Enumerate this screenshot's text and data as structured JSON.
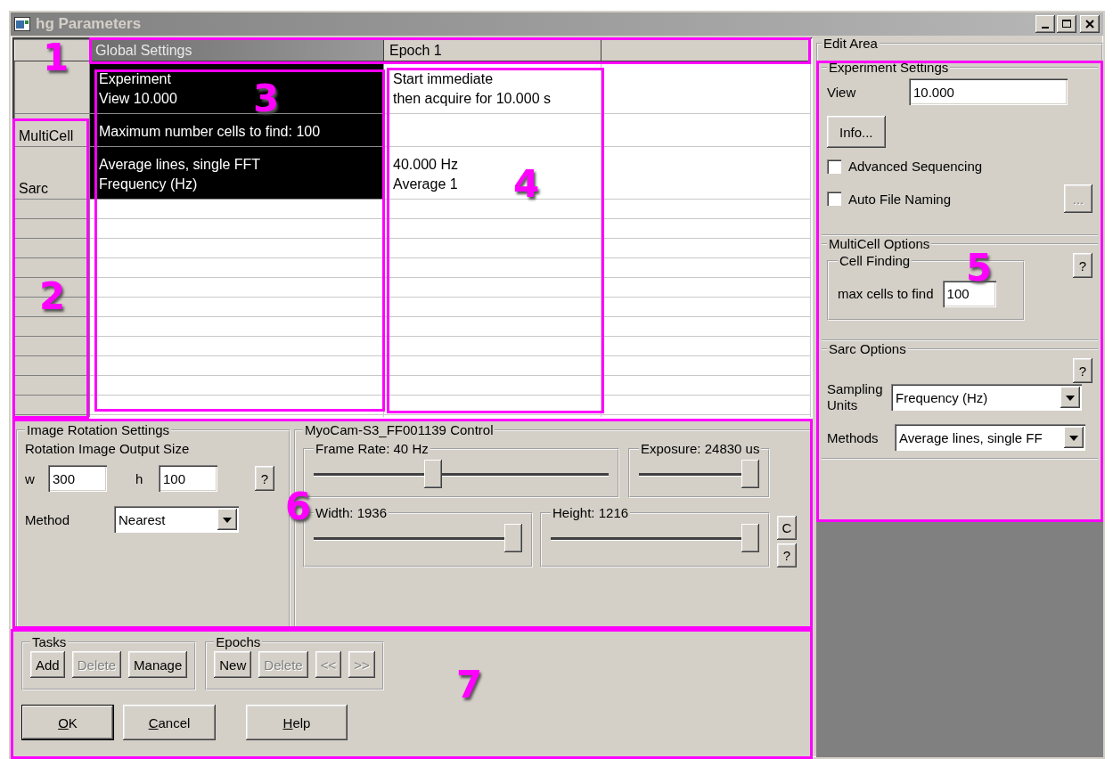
{
  "window": {
    "title": "hg Parameters"
  },
  "grid": {
    "columns": [
      {
        "label": "Global Settings",
        "selected": true
      },
      {
        "label": "Epoch 1",
        "selected": false
      }
    ],
    "rows": [
      {
        "cells": [
          {
            "lines": [
              "Experiment",
              "View 10.000"
            ]
          },
          {
            "lines": [
              "Start immediate",
              "then acquire for 10.000 s"
            ]
          }
        ]
      },
      {
        "header": "MultiCell",
        "cells": [
          {
            "lines": [
              "Maximum number cells to find: 100"
            ]
          }
        ]
      },
      {
        "header": "Sarc",
        "cells": [
          {
            "lines": [
              "Average lines, single FFT",
              "Frequency (Hz)"
            ]
          },
          {
            "lines": [
              "40.000 Hz",
              "Average 1"
            ]
          }
        ]
      }
    ]
  },
  "rotation": {
    "title": "Image Rotation Settings",
    "subtitle": "Rotation Image Output Size",
    "w_label": "w",
    "w_value": "300",
    "h_label": "h",
    "h_value": "100",
    "help": "?",
    "method_label": "Method",
    "method_value": "Nearest"
  },
  "camera": {
    "title": "MyoCam-S3_FF001139 Control",
    "sliders": [
      {
        "label": "Frame Rate: 40 Hz",
        "level": 0.4
      },
      {
        "label": "Exposure: 24830 us",
        "level": 1
      },
      {
        "label": "Width: 1936",
        "level": 1
      },
      {
        "label": "Height: 1216",
        "level": 1
      }
    ],
    "buttons": [
      "C",
      "?"
    ]
  },
  "tasks": {
    "title": "Tasks",
    "buttons": [
      {
        "label": "Add",
        "disabled": false
      },
      {
        "label": "Delete",
        "disabled": true
      },
      {
        "label": "Manage",
        "disabled": false
      }
    ]
  },
  "epochs": {
    "title": "Epochs",
    "buttons": [
      {
        "label": "New",
        "disabled": false
      },
      {
        "label": "Delete",
        "disabled": true
      },
      {
        "label": "<<",
        "disabled": true
      },
      {
        "label": ">>",
        "disabled": true
      }
    ]
  },
  "dialog_buttons": [
    {
      "label": "OK",
      "default": true
    },
    {
      "label": "Cancel",
      "default": false
    },
    {
      "label": "Help",
      "default": false
    }
  ],
  "edit_area": {
    "title": "Edit Area",
    "experiment": {
      "title": "Experiment Settings",
      "view_label": "View",
      "view_value": "10.000",
      "info_button": "Info...",
      "checkboxes": [
        {
          "label": "Advanced Sequencing",
          "checked": false
        },
        {
          "label": "Auto File Naming",
          "checked": false
        }
      ],
      "browse_button": {
        "label": "...",
        "disabled": true
      }
    },
    "multicell": {
      "title": "MultiCell Options",
      "help": "?",
      "group": "Cell Finding",
      "max_label": "max cells to find",
      "max_value": "100"
    },
    "sarc": {
      "title": "Sarc Options",
      "help": "?",
      "units_label": "Sampling Units",
      "units_value": "Frequency (Hz)",
      "methods_label": "Methods",
      "methods_value": "Average lines, single FF"
    }
  },
  "callouts": [
    {
      "label": "1"
    },
    {
      "label": "2"
    },
    {
      "label": "3"
    },
    {
      "label": "4"
    },
    {
      "label": "5"
    },
    {
      "label": "6"
    },
    {
      "label": "7"
    }
  ]
}
